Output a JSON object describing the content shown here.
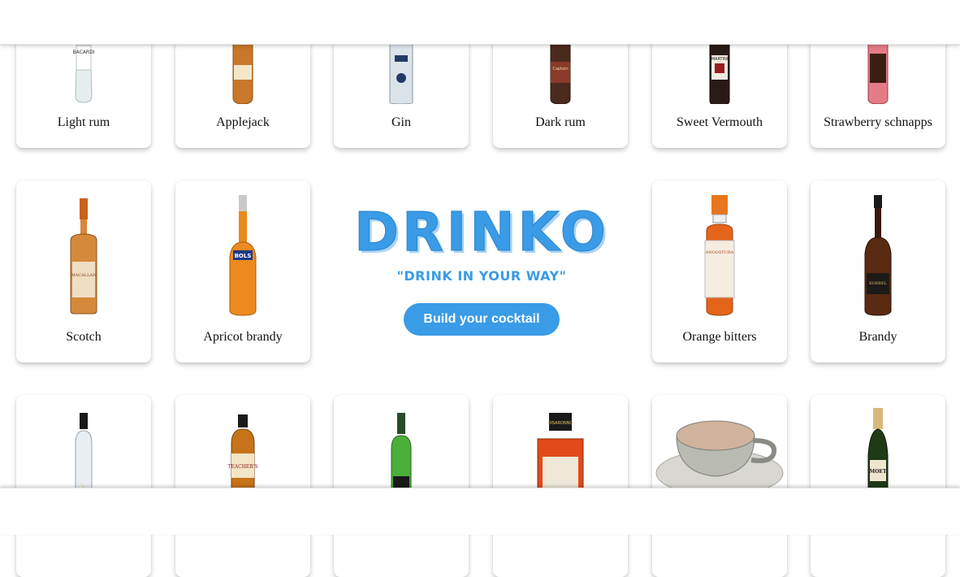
{
  "brand": {
    "logo_text": "DRINKO",
    "tagline": "\"DRINK IN YOUR WAY\"",
    "cta_label": "Build your cocktail"
  },
  "colors": {
    "accent": "#3a9be6"
  },
  "ingredients": [
    {
      "name": "Light rum",
      "icon": "light-rum-bottle-icon"
    },
    {
      "name": "Applejack",
      "icon": "applejack-bottle-icon"
    },
    {
      "name": "Gin",
      "icon": "gin-bottle-icon"
    },
    {
      "name": "Dark rum",
      "icon": "dark-rum-bottle-icon"
    },
    {
      "name": "Sweet Vermouth",
      "icon": "sweet-vermouth-bottle-icon"
    },
    {
      "name": "Strawberry schnapps",
      "icon": "strawberry-schnapps-bottle-icon"
    },
    {
      "name": "Scotch",
      "icon": "scotch-bottle-icon"
    },
    {
      "name": "Apricot brandy",
      "icon": "apricot-brandy-bottle-icon"
    },
    {
      "name": "Orange bitters",
      "icon": "orange-bitters-bottle-icon"
    },
    {
      "name": "Brandy",
      "icon": "brandy-bottle-icon"
    },
    {
      "name": "",
      "icon": "vodka-bottle-icon"
    },
    {
      "name": "",
      "icon": "whisky-bottle-icon"
    },
    {
      "name": "",
      "icon": "green-vermouth-bottle-icon"
    },
    {
      "name": "",
      "icon": "amaretto-bottle-icon"
    },
    {
      "name": "",
      "icon": "tea-cup-icon"
    },
    {
      "name": "",
      "icon": "champagne-bottle-icon"
    }
  ]
}
